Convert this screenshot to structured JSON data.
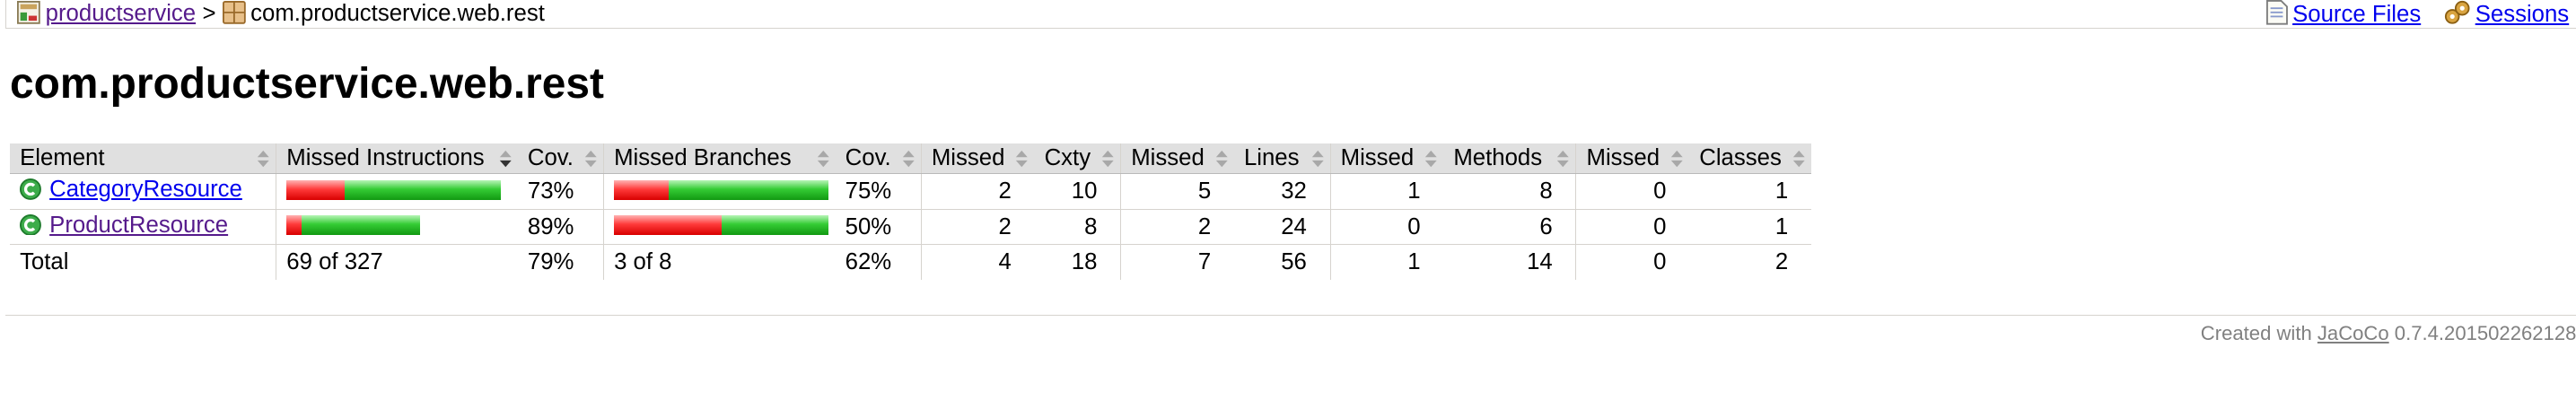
{
  "breadcrumb": {
    "root_label": "productservice",
    "separator": ">",
    "current_label": "com.productservice.web.rest"
  },
  "top_links": {
    "source_files": "Source Files",
    "sessions": "Sessions"
  },
  "page_title": "com.productservice.web.rest",
  "table": {
    "headers": {
      "element": "Element",
      "missed_instructions": "Missed Instructions",
      "cov1": "Cov.",
      "missed_branches": "Missed Branches",
      "cov2": "Cov.",
      "missed_cxty": "Missed",
      "cxty": "Cxty",
      "missed_lines": "Missed",
      "lines": "Lines",
      "missed_methods": "Missed",
      "methods": "Methods",
      "missed_classes": "Missed",
      "classes": "Classes"
    },
    "rows": [
      {
        "name": "CategoryResource",
        "instr_missed_fraction": 0.27,
        "instr_bar_scale": 1.0,
        "instr_cov": "73%",
        "branch_missed_fraction": 0.25,
        "branch_bar_scale": 1.0,
        "branch_cov": "75%",
        "missed_cxty": "2",
        "cxty": "10",
        "missed_lines": "5",
        "lines": "32",
        "missed_methods": "1",
        "methods": "8",
        "missed_classes": "0",
        "classes": "1"
      },
      {
        "name": "ProductResource",
        "instr_missed_fraction": 0.11,
        "instr_bar_scale": 0.62,
        "instr_cov": "89%",
        "branch_missed_fraction": 0.5,
        "branch_bar_scale": 1.0,
        "branch_cov": "50%",
        "missed_cxty": "2",
        "cxty": "8",
        "missed_lines": "2",
        "lines": "24",
        "missed_methods": "0",
        "methods": "6",
        "missed_classes": "0",
        "classes": "1"
      }
    ],
    "total": {
      "label": "Total",
      "instructions": "69 of 327",
      "instr_cov": "79%",
      "branches": "3 of 8",
      "branch_cov": "62%",
      "missed_cxty": "4",
      "cxty": "18",
      "missed_lines": "7",
      "lines": "56",
      "missed_methods": "1",
      "methods": "14",
      "missed_classes": "0",
      "classes": "2"
    }
  },
  "footer": {
    "prefix": "Created with",
    "link": "JaCoCo",
    "version": "0.7.4.201502262128"
  },
  "colors": {
    "missed_bar": "#ff3b3b",
    "covered_bar": "#35cc35",
    "header_bg": "#e0e0e0"
  },
  "icons": {
    "report": "report-icon",
    "package": "package-icon",
    "source_files": "source-files-icon",
    "sessions": "sessions-icon",
    "class": "class-icon",
    "sort": "sort-arrows-icon"
  }
}
